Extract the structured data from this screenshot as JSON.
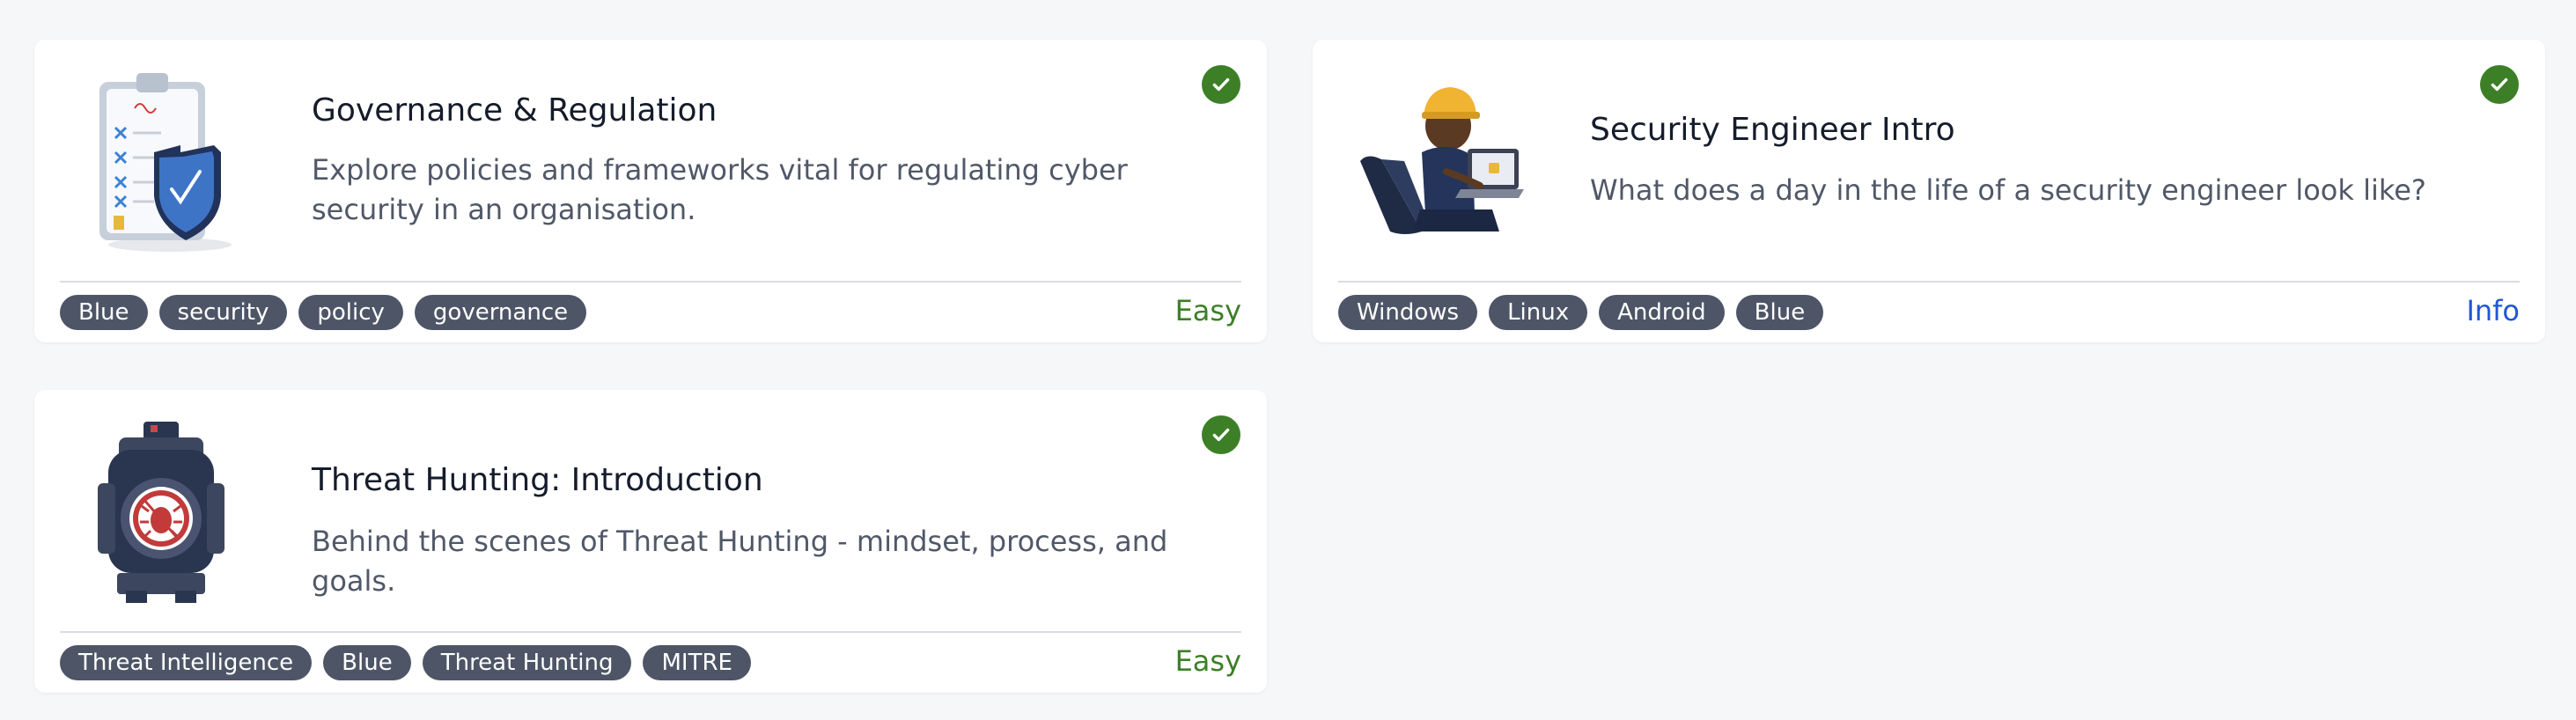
{
  "cards": [
    {
      "title": "Governance & Regulation",
      "description": "Explore policies and frameworks vital for regulating cyber security in an organisation.",
      "tags": [
        "Blue",
        "security",
        "policy",
        "governance"
      ],
      "difficulty": "Easy",
      "difficulty_color": "#3c7f27",
      "completed_icon": "check-circle-icon",
      "image_icon": "clipboard-shield-icon"
    },
    {
      "title": "Security Engineer Intro",
      "description": "What does a day in the life of a security engineer look like?",
      "tags": [
        "Windows",
        "Linux",
        "Android",
        "Blue"
      ],
      "difficulty": "Info",
      "difficulty_color": "#2156d6",
      "completed_icon": "check-circle-icon",
      "image_icon": "engineer-laptop-icon"
    },
    {
      "title": "Threat Hunting: Introduction",
      "description": "Behind the scenes of Threat Hunting - mindset, process, and goals.",
      "tags": [
        "Threat Intelligence",
        "Blue",
        "Threat Hunting",
        "MITRE"
      ],
      "difficulty": "Easy",
      "difficulty_color": "#3c7f27",
      "completed_icon": "check-circle-icon",
      "image_icon": "scope-bug-icon"
    }
  ],
  "colors": {
    "page_background": "#f6f7f9",
    "card_background": "#ffffff",
    "tag_background": "#4d5566",
    "tag_text": "#ffffff",
    "completed_badge": "#3c7f27",
    "divider": "#d9dce1"
  }
}
